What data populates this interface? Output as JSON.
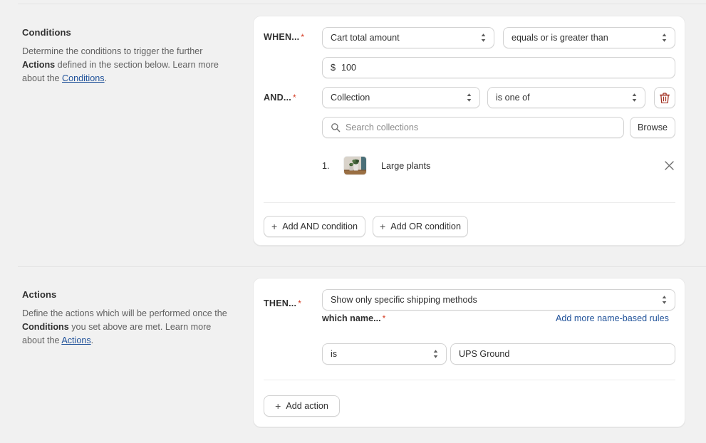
{
  "conditions": {
    "title": "Conditions",
    "desc_1": "Determine the conditions to trigger the further ",
    "desc_bold": "Actions",
    "desc_2": " defined in the section below. Learn more about the ",
    "desc_link": "Conditions",
    "desc_3": ".",
    "when_label": "WHEN...",
    "when_required": "*",
    "when_field": "Cart total amount",
    "when_operator": "equals or is greater than",
    "amount_prefix": "$",
    "amount_value": "100",
    "and_label": "AND...",
    "and_required": "*",
    "and_field": "Collection",
    "and_operator": "is one of",
    "delete_icon": "trash-icon",
    "search_placeholder": "Search collections",
    "browse_label": "Browse",
    "collections": [
      {
        "index": "1.",
        "name": "Large plants",
        "thumb": "large-plants-thumbnail"
      }
    ],
    "add_and_label": "Add AND condition",
    "add_or_label": "Add OR condition",
    "plus": "+"
  },
  "actions": {
    "title": "Actions",
    "desc_1": "Define the actions which will be performed once the ",
    "desc_bold": "Conditions",
    "desc_2": " you set above are met. Learn more about the ",
    "desc_link": "Actions",
    "desc_3": ".",
    "then_label": "THEN...",
    "then_required": "*",
    "then_value": "Show only specific shipping methods",
    "which_name_label": "which name...",
    "which_name_required": "*",
    "add_rules_link": "Add more name-based rules",
    "name_operator": "is",
    "name_value": "UPS Ground",
    "add_action_label": "Add action",
    "plus": "+"
  },
  "colors": {
    "accent_link": "#1f5199",
    "required_star": "#d43b22",
    "danger": "#a02c1c",
    "page_bg": "#f1f1f1",
    "card_bg": "#ffffff"
  }
}
